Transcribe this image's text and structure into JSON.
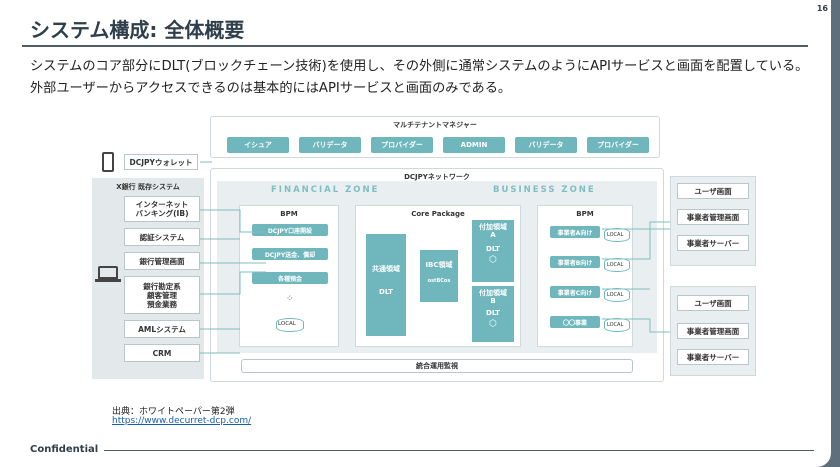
{
  "page_number": "16",
  "title": "システム構成: 全体概要",
  "lead": "システムのコア部分にDLT(ブロックチェーン技術)を使用し、その外側に通常システムのようにAPIサービスと画面を配置している。外部ユーザーからアクセスできるのは基本的にはAPIサービスと画面のみである。",
  "footer": {
    "confidential": "Confidential"
  },
  "source": {
    "label": "出典：ホワイトペーパー第2弾",
    "url": "https://www.decurret-dcp.com/"
  },
  "diagram": {
    "multitenant": {
      "title": "マルチテナントマネジャー",
      "items": [
        "イシュア",
        "バリデータ",
        "プロバイダー",
        "ADMIN",
        "バリデータ",
        "プロバイダー"
      ]
    },
    "wallet": "DCJPYウォレット",
    "bank_system": {
      "title": "X銀行 既存システム",
      "items": [
        "インターネット\nバンキング(IB)",
        "認証システム",
        "銀行管理画面",
        "銀行勘定系\n顧客管理\n預金業務",
        "AMLシステム",
        "CRM"
      ]
    },
    "network_title": "DCJPYネットワーク",
    "financial_zone": {
      "label": "FINANCIAL ZONE",
      "bpm_title": "BPM",
      "items": [
        "DCJPY口座開設",
        "DCJPY送金、償却",
        "各種預金"
      ],
      "local": "LOCAL"
    },
    "core": {
      "title": "Core Package",
      "common": "共通領域",
      "dlt": "DLT",
      "ibc": "IBC領域",
      "ibc_sub": "ostBCos",
      "addA": "付加領域\nA",
      "addB": "付加領域\nB"
    },
    "business_zone": {
      "label": "BUSINESS ZONE",
      "bpm_title": "BPM",
      "items": [
        "事業者A向け",
        "事業者B向け",
        "事業者C向け",
        "〇〇事業"
      ],
      "local": "LOCAL"
    },
    "monitoring": "統合運用監視",
    "right_group1": [
      "ユーザ画面",
      "事業者管理画面",
      "事業者サーバー"
    ],
    "right_group2": [
      "ユーザ画面",
      "事業者管理画面",
      "事業者サーバー"
    ]
  }
}
